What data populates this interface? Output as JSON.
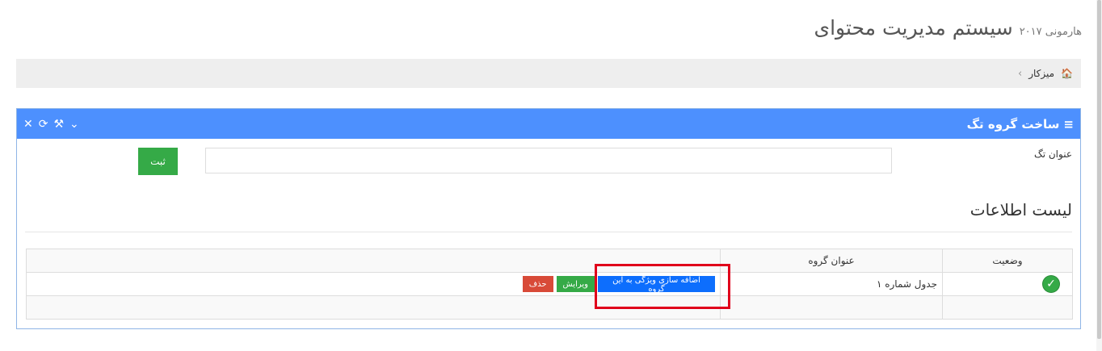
{
  "header": {
    "title": "سیستم مدیریت محتوای",
    "subtitle": "هارمونی ۲۰۱۷"
  },
  "breadcrumb": {
    "home_label": "میزکار",
    "home_icon": "home-icon",
    "chevron": "‹"
  },
  "portlet": {
    "title": "ساخت گروه تگ",
    "title_icon": "≡",
    "tools": [
      "chevron-down-icon",
      "wrench-icon",
      "refresh-icon",
      "close-icon"
    ],
    "header_color": "#4d90fe"
  },
  "form": {
    "label": "عنوان تگ",
    "input_value": "",
    "submit_label": "ثبت"
  },
  "list": {
    "title": "لیست اطلاعات",
    "columns": [
      "وضعیت",
      "عنوان گروه",
      ""
    ],
    "rows": [
      {
        "status": "active",
        "group_title": "جدول شماره ۱",
        "actions": {
          "add_feature": "اضافه سازی ویژگی به این گروه",
          "edit": "ویرایش",
          "delete": "حذف"
        }
      }
    ]
  },
  "colors": {
    "primary": "#4d90fe",
    "success": "#35aa47",
    "danger": "#d84a38",
    "action_blue": "#0d6efd",
    "highlight": "#e0001b"
  }
}
